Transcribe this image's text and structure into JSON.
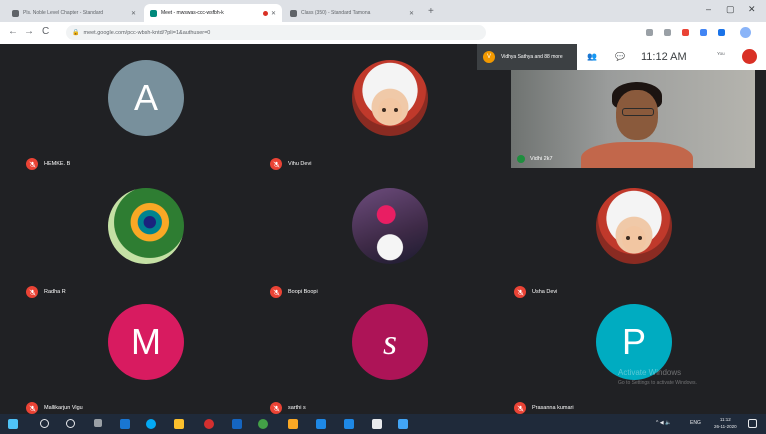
{
  "browser": {
    "tabs": [
      {
        "label": "Pls. Noble Level Chapter - Standard",
        "active": false,
        "fav_color": "#5f6368"
      },
      {
        "label": "Meet - mwswas-ccc-wsfbh-k",
        "active": true,
        "fav_color": "#00897b",
        "recording": true
      },
      {
        "label": "Class (350) - Standard Tamona",
        "active": false,
        "fav_color": "#5f6368"
      }
    ],
    "new_tab": "+",
    "window_controls": [
      "–",
      "▢",
      "✕"
    ],
    "nav": [
      "←",
      "→",
      "C"
    ],
    "url": "meet.google.com/pcc-wbsh-kntd/?pli=1&authuser=0"
  },
  "meet": {
    "joined_text": "Vidhya Sathya and 88 more",
    "joined_initial": "V",
    "time": "11:12 AM",
    "you_label": "You",
    "presenter_name": "Vidhi 2k7",
    "participants": [
      {
        "name": "HEMKE. B",
        "avatar_type": "letter",
        "letter": "A",
        "bg": "#78909c"
      },
      {
        "name": "Vihu Devi",
        "avatar_type": "baby"
      },
      {
        "name": "Radha R",
        "avatar_type": "feather"
      },
      {
        "name": "Boopi Boopi",
        "avatar_type": "flower"
      },
      {
        "name": "Usha Devi",
        "avatar_type": "baby"
      },
      {
        "name": "Mallikarjun Vigu",
        "avatar_type": "letter",
        "letter": "M",
        "bg": "#d81b60"
      },
      {
        "name": "sarthi s",
        "avatar_type": "letter",
        "letter": "s",
        "bg": "#ad1457"
      },
      {
        "name": "Prasanna kumari",
        "avatar_type": "letter",
        "letter": "P",
        "bg": "#00acc1"
      }
    ]
  },
  "watermark": {
    "line1": "Activate Windows",
    "line2": "Go to Settings to activate Windows."
  },
  "taskbar": {
    "clock_time": "11:12",
    "clock_date": "26-11-2020",
    "lang": "ENG"
  },
  "colors": {
    "micoff": "#ea4335",
    "bg": "#202124"
  }
}
